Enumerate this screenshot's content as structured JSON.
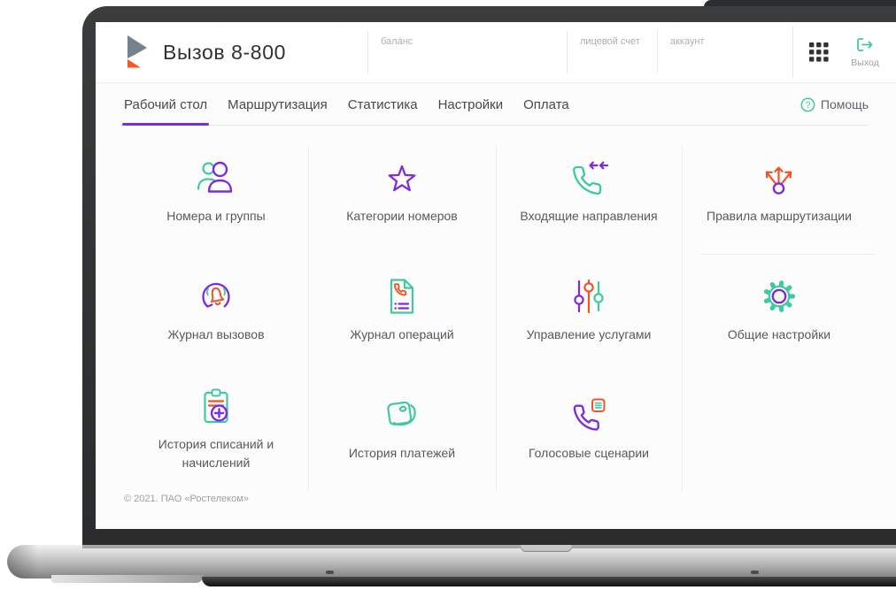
{
  "colors": {
    "purple": "#7e2be0",
    "teal": "#3fc9a1",
    "orange": "#ee5526"
  },
  "header": {
    "title": "Вызов 8-800",
    "balance_label": "баланс",
    "personal_account_label": "лицевой счет",
    "account_label": "аккаунт",
    "logout_label": "Выход"
  },
  "nav": {
    "tabs": [
      {
        "label": "Рабочий стол"
      },
      {
        "label": "Маршрутизация"
      },
      {
        "label": "Статистика"
      },
      {
        "label": "Настройки"
      },
      {
        "label": "Оплата"
      }
    ],
    "active_tab": "Рабочий стол",
    "help_label": "Помощь"
  },
  "tiles": [
    {
      "name": "numbers-and-groups",
      "label": "Номера и группы",
      "icon": "users-icon"
    },
    {
      "name": "number-categories",
      "label": "Категории номеров",
      "icon": "star-icon"
    },
    {
      "name": "incoming-directions",
      "label": "Входящие направления",
      "icon": "phone-incoming-icon"
    },
    {
      "name": "routing-rules",
      "label": "Правила маршрутизации",
      "icon": "route-branch-icon"
    },
    {
      "name": "call-log",
      "label": "Журнал вызовов",
      "icon": "bell-history-icon"
    },
    {
      "name": "operations-log",
      "label": "Журнал операций",
      "icon": "document-phone-icon"
    },
    {
      "name": "service-management",
      "label": "Управление услугами",
      "icon": "sliders-icon"
    },
    {
      "name": "general-settings",
      "label": "Общие настройки",
      "icon": "gear-icon"
    },
    {
      "name": "charges-history",
      "label": "История списаний и начислений",
      "icon": "clipboard-plus-icon"
    },
    {
      "name": "payments-history",
      "label": "История платежей",
      "icon": "wallet-icon"
    },
    {
      "name": "voice-scenarios",
      "label": "Голосовые сценарии",
      "icon": "phone-script-icon"
    }
  ],
  "footer": {
    "copyright": "© 2021. ПАО «Ростелеком»"
  }
}
